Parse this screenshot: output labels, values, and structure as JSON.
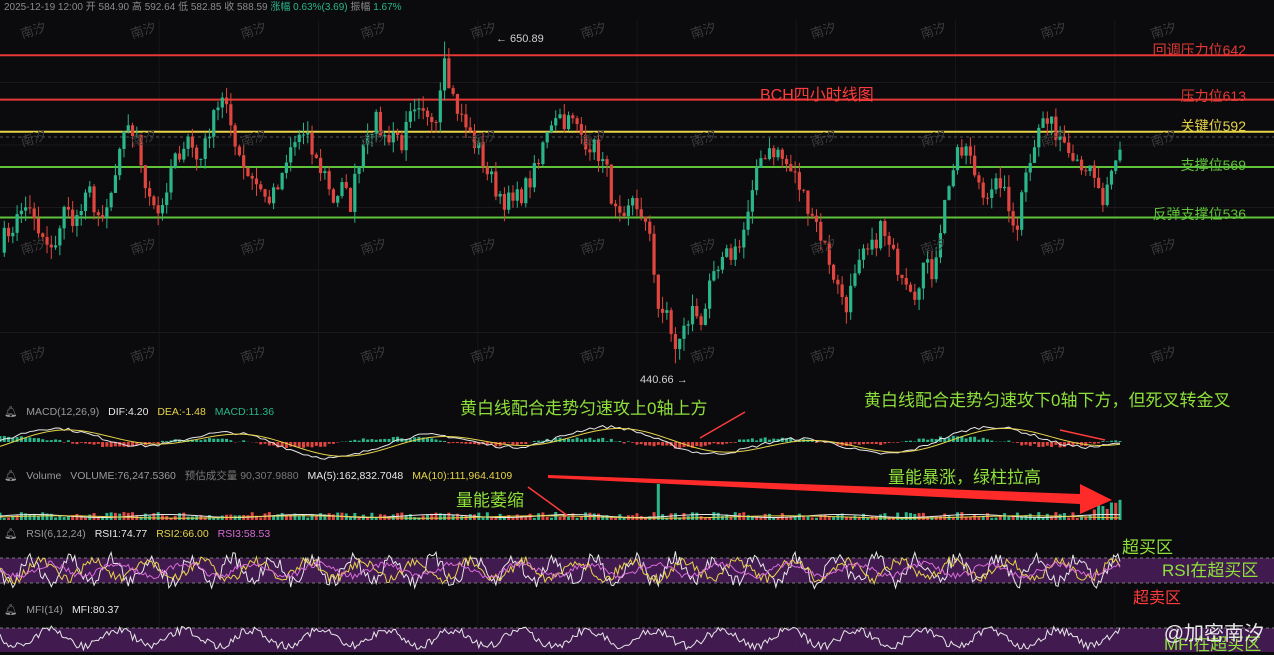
{
  "header": {
    "date": "2025-12-19 12:00",
    "open_label": "开",
    "open": "584.90",
    "high_label": "高",
    "high": "592.64",
    "low_label": "低",
    "low": "582.85",
    "close_label": "收",
    "close": "588.59",
    "change_label": "涨幅",
    "change": "0.63%(3.69)",
    "amp_label": "振幅",
    "amp": "1.67%"
  },
  "title": "BCH四小时线图",
  "chart_data": {
    "type": "candlestick",
    "title": "BCH四小时线图",
    "ylim": [
      420,
      665
    ],
    "high_marker": 650.89,
    "low_marker": 440.66,
    "levels": [
      {
        "label": "回调压力位642",
        "value": 642,
        "color": "#e53935"
      },
      {
        "label": "压力位613",
        "value": 613,
        "color": "#e53935"
      },
      {
        "label": "关键位592",
        "value": 592,
        "color": "#e6d34a"
      },
      {
        "label": "支撑位569",
        "value": 569,
        "color": "#5fc23a"
      },
      {
        "label": "反弹支撑位536",
        "value": 536,
        "color": "#5fc23a"
      }
    ],
    "price_path": [
      [
        0,
        520
      ],
      [
        3,
        530
      ],
      [
        6,
        545
      ],
      [
        9,
        525
      ],
      [
        12,
        512
      ],
      [
        15,
        540
      ],
      [
        18,
        535
      ],
      [
        21,
        552
      ],
      [
        24,
        530
      ],
      [
        26,
        550
      ],
      [
        28,
        575
      ],
      [
        30,
        598
      ],
      [
        32,
        585
      ],
      [
        34,
        560
      ],
      [
        36,
        545
      ],
      [
        38,
        538
      ],
      [
        40,
        565
      ],
      [
        42,
        580
      ],
      [
        44,
        588
      ],
      [
        46,
        575
      ],
      [
        48,
        582
      ],
      [
        50,
        608
      ],
      [
        52,
        612
      ],
      [
        54,
        596
      ],
      [
        56,
        578
      ],
      [
        58,
        565
      ],
      [
        60,
        560
      ],
      [
        62,
        548
      ],
      [
        64,
        550
      ],
      [
        66,
        560
      ],
      [
        68,
        580
      ],
      [
        70,
        590
      ],
      [
        72,
        585
      ],
      [
        74,
        572
      ],
      [
        76,
        565
      ],
      [
        78,
        548
      ],
      [
        80,
        555
      ],
      [
        82,
        545
      ],
      [
        84,
        575
      ],
      [
        86,
        595
      ],
      [
        88,
        598
      ],
      [
        90,
        588
      ],
      [
        92,
        592
      ],
      [
        94,
        585
      ],
      [
        96,
        600
      ],
      [
        98,
        602
      ],
      [
        100,
        598
      ],
      [
        102,
        605
      ],
      [
        104,
        640
      ],
      [
        106,
        615
      ],
      [
        108,
        600
      ],
      [
        110,
        590
      ],
      [
        112,
        580
      ],
      [
        114,
        566
      ],
      [
        116,
        555
      ],
      [
        118,
        548
      ],
      [
        120,
        545
      ],
      [
        122,
        552
      ],
      [
        124,
        560
      ],
      [
        126,
        570
      ],
      [
        128,
        595
      ],
      [
        130,
        605
      ],
      [
        132,
        600
      ],
      [
        134,
        598
      ],
      [
        136,
        590
      ],
      [
        138,
        584
      ],
      [
        140,
        578
      ],
      [
        142,
        565
      ],
      [
        144,
        538
      ],
      [
        146,
        530
      ],
      [
        148,
        545
      ],
      [
        150,
        540
      ],
      [
        152,
        520
      ],
      [
        154,
        480
      ],
      [
        156,
        470
      ],
      [
        158,
        448
      ],
      [
        160,
        462
      ],
      [
        162,
        475
      ],
      [
        164,
        470
      ],
      [
        166,
        488
      ],
      [
        168,
        500
      ],
      [
        170,
        510
      ],
      [
        172,
        515
      ],
      [
        174,
        528
      ],
      [
        176,
        550
      ],
      [
        178,
        575
      ],
      [
        180,
        582
      ],
      [
        182,
        578
      ],
      [
        184,
        570
      ],
      [
        186,
        562
      ],
      [
        188,
        550
      ],
      [
        190,
        540
      ],
      [
        192,
        525
      ],
      [
        194,
        508
      ],
      [
        196,
        490
      ],
      [
        198,
        480
      ],
      [
        200,
        495
      ],
      [
        202,
        510
      ],
      [
        204,
        515
      ],
      [
        206,
        530
      ],
      [
        208,
        515
      ],
      [
        210,
        505
      ],
      [
        212,
        498
      ],
      [
        214,
        488
      ],
      [
        216,
        505
      ],
      [
        218,
        500
      ],
      [
        220,
        530
      ],
      [
        222,
        560
      ],
      [
        224,
        575
      ],
      [
        226,
        580
      ],
      [
        228,
        565
      ],
      [
        230,
        555
      ],
      [
        232,
        550
      ],
      [
        234,
        560
      ],
      [
        236,
        540
      ],
      [
        238,
        532
      ],
      [
        240,
        570
      ],
      [
        242,
        585
      ],
      [
        244,
        600
      ],
      [
        246,
        595
      ],
      [
        248,
        590
      ],
      [
        250,
        585
      ],
      [
        252,
        575
      ],
      [
        254,
        570
      ],
      [
        256,
        558
      ],
      [
        258,
        545
      ],
      [
        260,
        560
      ],
      [
        262,
        578
      ]
    ],
    "rsi_overbought_label": "超买区",
    "rsi_oversold_label": "超卖区"
  },
  "levels_text": {
    "l642": "回调压力位642",
    "l613": "压力位613",
    "l592": "关键位592",
    "l569": "支撑位569",
    "l536": "反弹支撑位536"
  },
  "markers": {
    "high": "← 650.89",
    "low": "440.66 →"
  },
  "annotations": {
    "macd_up": "黄白线配合走势匀速攻上0轴上方",
    "macd_down": "黄白线配合走势匀速攻下0轴下方，但死叉转金叉",
    "vol_shrink": "量能萎缩",
    "vol_surge": "量能暴涨，绿柱拉高",
    "rsi_ob": "超买区",
    "rsi_in_ob": "RSI在超买区",
    "rsi_os": "超卖区",
    "mfi_in_ob": "MFI在超买区"
  },
  "macd": {
    "name": "MACD(12,26,9)",
    "dif": "DIF:4.20",
    "dea": "DEA:-1.48",
    "macd": "MACD:11.36"
  },
  "volume": {
    "name": "Volume",
    "vol": "VOLUME:76,247.5360",
    "est": "预估成交量 90,307.9880",
    "ma5": "MA(5):162,832.7048",
    "ma10": "MA(10):111,964.4109"
  },
  "rsi": {
    "name": "RSI(6,12,24)",
    "rsi1": "RSI1:74.77",
    "rsi2": "RSI2:66.00",
    "rsi3": "RSI3:58.53"
  },
  "mfi": {
    "name": "MFI(14)",
    "mfi": "MFI:80.37"
  },
  "watermark": "南汐",
  "brand": "@加密南汐",
  "colors": {
    "up": "#2ab58a",
    "down": "#e0463f",
    "yellow": "#e6d34a",
    "white": "#e8e8e8",
    "purple": "#4b1f5c"
  }
}
